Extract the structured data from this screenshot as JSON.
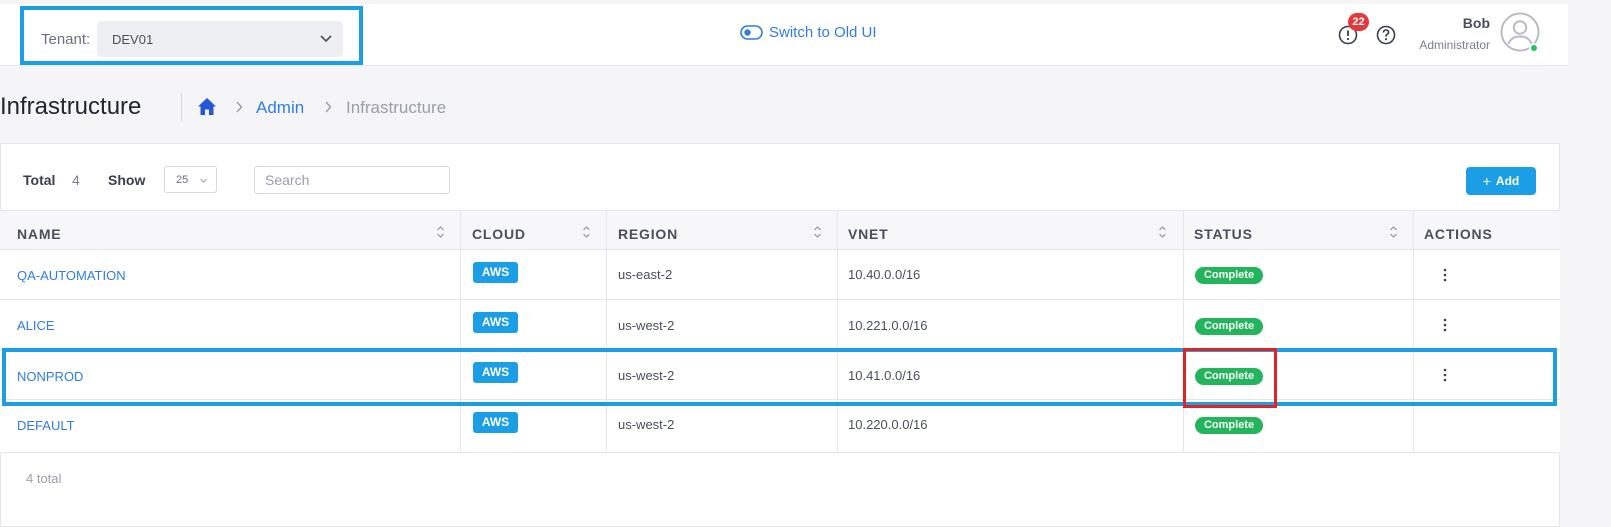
{
  "header": {
    "tenant_label": "Tenant:",
    "tenant_value": "DEV01",
    "switch_ui_label": "Switch to Old UI",
    "notification_count": "22",
    "user_name": "Bob",
    "user_role": "Administrator"
  },
  "page": {
    "title": "Infrastructure",
    "breadcrumb": [
      "Admin",
      "Infrastructure"
    ]
  },
  "toolbar": {
    "total_label": "Total",
    "total_value": "4",
    "show_label": "Show",
    "show_value": "25",
    "search_placeholder": "Search",
    "add_label": "Add"
  },
  "table": {
    "columns": [
      "NAME",
      "CLOUD",
      "REGION",
      "VNET",
      "STATUS",
      "ACTIONS"
    ],
    "rows": [
      {
        "name": "QA-AUTOMATION",
        "cloud": "AWS",
        "region": "us-east-2",
        "vnet": "10.40.0.0/16",
        "status": "Complete",
        "has_actions": true
      },
      {
        "name": "ALICE",
        "cloud": "AWS",
        "region": "us-west-2",
        "vnet": "10.221.0.0/16",
        "status": "Complete",
        "has_actions": true
      },
      {
        "name": "NONPROD",
        "cloud": "AWS",
        "region": "us-west-2",
        "vnet": "10.41.0.0/16",
        "status": "Complete",
        "has_actions": true
      },
      {
        "name": "DEFAULT",
        "cloud": "AWS",
        "region": "us-west-2",
        "vnet": "10.220.0.0/16",
        "status": "Complete",
        "has_actions": false
      }
    ],
    "footer_total": "4 total"
  },
  "colors": {
    "accent": "#1c9ee6",
    "link": "#2f7de1",
    "status_complete": "#22b55c",
    "highlight_red": "#e02424",
    "badge_alert": "#e5383b"
  }
}
